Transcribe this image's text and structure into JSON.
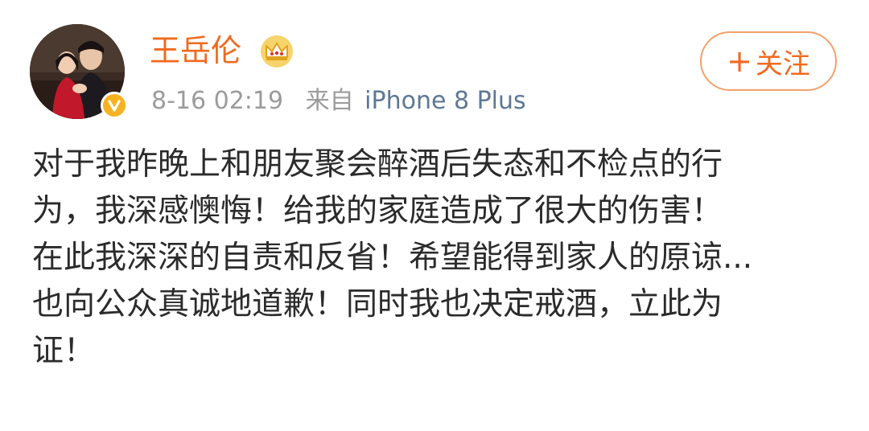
{
  "user": {
    "name": "王岳伦"
  },
  "post": {
    "time": "8-16 02:19",
    "source_prefix": "来自",
    "source_device": "iPhone 8 Plus",
    "lines": [
      "对于我昨晚上和朋友聚会醉酒后失态和不检点的行",
      "为，我深感懊悔！给我的家庭造成了很大的伤害！",
      "在此我深深的自责和反省！希望能得到家人的原谅...",
      "也向公众真诚地道歉！同时我也决定戒酒，立此为",
      "证！"
    ]
  },
  "follow": {
    "icon": "+",
    "label": "关注"
  },
  "icons": {
    "avatar": "user-photo",
    "verified": "verified-badge-icon",
    "crown": "crown-icon"
  },
  "colors": {
    "name": "#f06a1e",
    "verified_badge": "#f5b323",
    "follow_border": "#f5a06a",
    "meta": "#9b9b9b",
    "source_device": "#5d7895",
    "text": "#2b2b2b"
  }
}
